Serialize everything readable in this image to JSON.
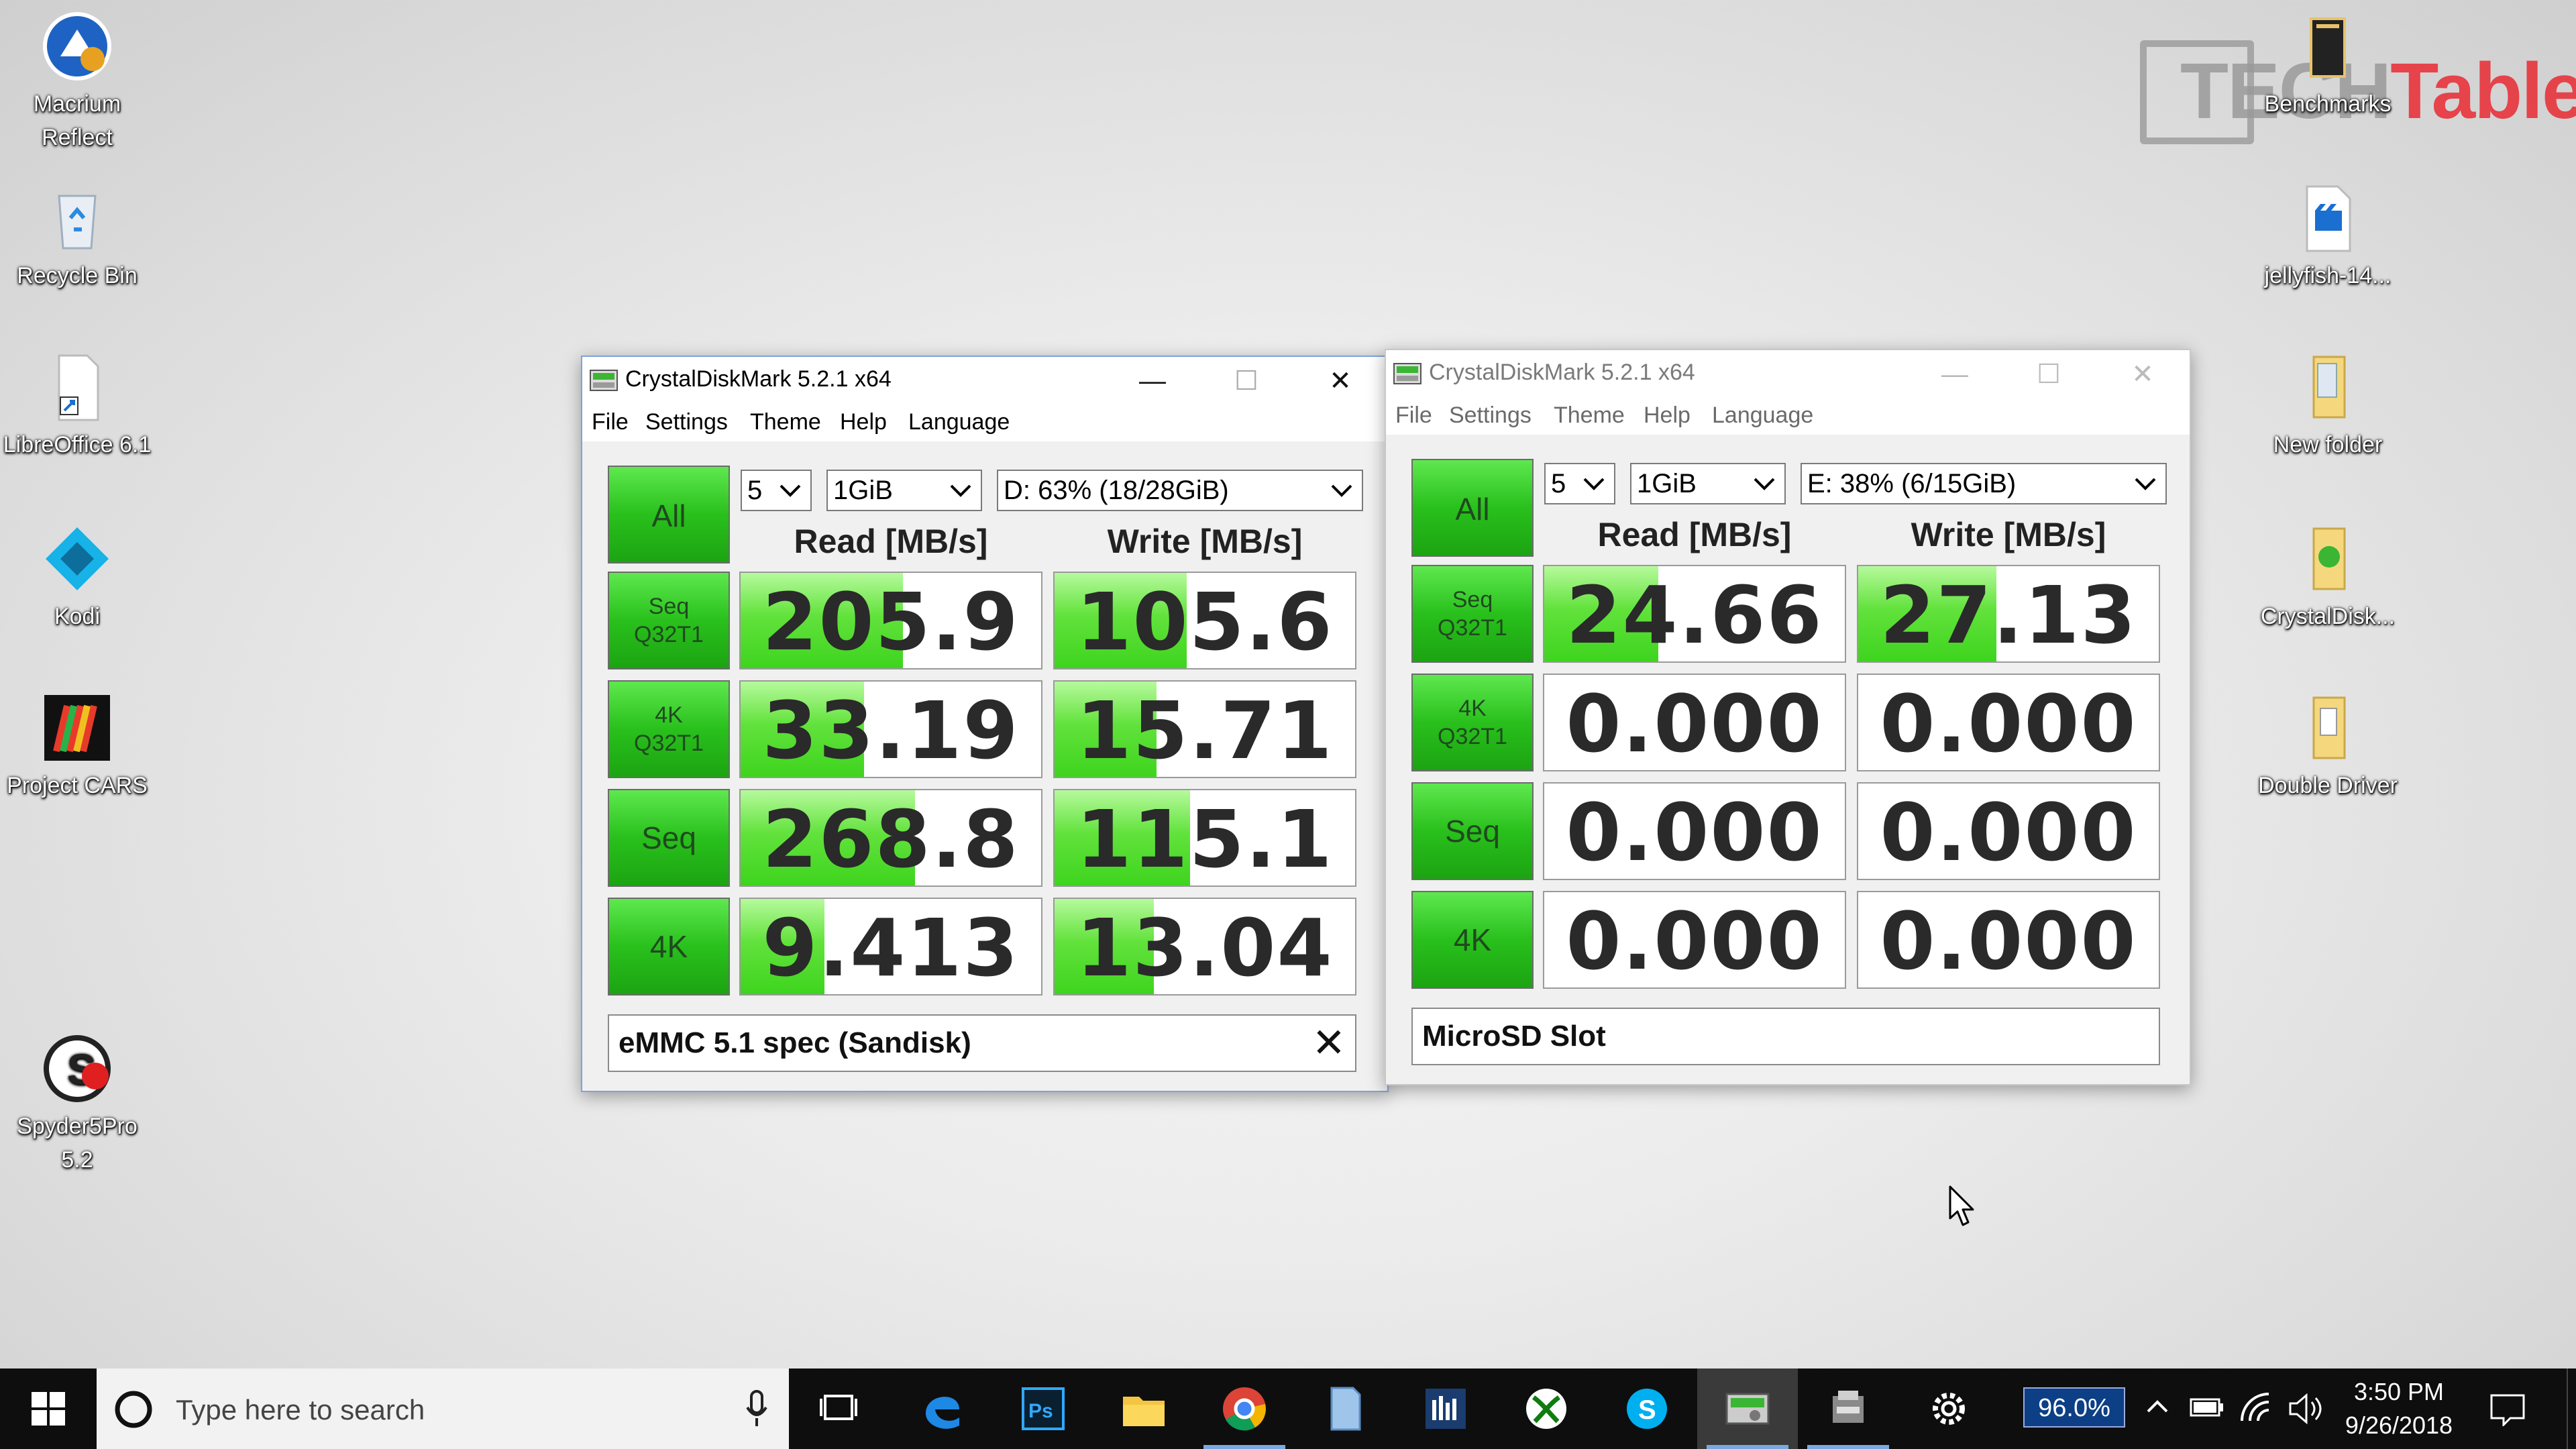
{
  "desktop": {
    "icons_left": [
      {
        "label": "Macrium Reflect",
        "icon": "macrium-reflect-icon"
      },
      {
        "label": "Recycle Bin",
        "icon": "recycle-bin-icon"
      },
      {
        "label": "LibreOffice 6.1",
        "icon": "libreoffice-icon"
      },
      {
        "label": "Kodi",
        "icon": "kodi-icon"
      },
      {
        "label": "Project CARS",
        "icon": "project-cars-icon"
      },
      {
        "label": "Spyder5Pro 5.2",
        "icon": "spyder5pro-icon"
      }
    ],
    "icons_right": [
      {
        "label": "Benchmarks",
        "icon": "benchmarks-folder-icon"
      },
      {
        "label": "jellyfish-14...",
        "icon": "video-file-icon"
      },
      {
        "label": "New folder",
        "icon": "folder-icon"
      },
      {
        "label": "CrystalDisk...",
        "icon": "crystaldisk-shortcut-icon"
      },
      {
        "label": "Double Driver",
        "icon": "folder-icon"
      }
    ],
    "watermark": {
      "part1": "TECH",
      "part2": "Tablets"
    }
  },
  "windows": [
    {
      "title": "CrystalDiskMark 5.2.1 x64",
      "active": true,
      "menu": [
        "File",
        "Settings",
        "Theme",
        "Help",
        "Language"
      ],
      "all_label": "All",
      "count": "5",
      "size": "1GiB",
      "drive": "D: 63% (18/28GiB)",
      "read_header": "Read [MB/s]",
      "write_header": "Write [MB/s]",
      "rows": [
        {
          "line1": "Seq",
          "line2": "Q32T1",
          "read": "205.9",
          "write": "105.6"
        },
        {
          "line1": "4K",
          "line2": "Q32T1",
          "read": "33.19",
          "write": "15.71"
        },
        {
          "line1": "Seq",
          "line2": "",
          "read": "268.8",
          "write": "115.1"
        },
        {
          "line1": "4K",
          "line2": "",
          "read": "9.413",
          "write": "13.04"
        }
      ],
      "comment": "eMMC 5.1 spec (Sandisk)"
    },
    {
      "title": "CrystalDiskMark 5.2.1 x64",
      "active": false,
      "menu": [
        "File",
        "Settings",
        "Theme",
        "Help",
        "Language"
      ],
      "all_label": "All",
      "count": "5",
      "size": "1GiB",
      "drive": "E: 38% (6/15GiB)",
      "read_header": "Read [MB/s]",
      "write_header": "Write [MB/s]",
      "rows": [
        {
          "line1": "Seq",
          "line2": "Q32T1",
          "read": "24.66",
          "write": "27.13"
        },
        {
          "line1": "4K",
          "line2": "Q32T1",
          "read": "0.000",
          "write": "0.000"
        },
        {
          "line1": "Seq",
          "line2": "",
          "read": "0.000",
          "write": "0.000"
        },
        {
          "line1": "4K",
          "line2": "",
          "read": "0.000",
          "write": "0.000"
        }
      ],
      "comment": "MicroSD Slot"
    }
  ],
  "taskbar": {
    "search_placeholder": "Type here to search",
    "pinned": [
      "task-view-icon",
      "edge-icon",
      "photoshop-icon",
      "file-explorer-icon",
      "chrome-icon",
      "notepad-icon",
      "app-icon",
      "xbox-icon",
      "skype-icon",
      "crystaldiskmark-icon",
      "app-icon-2",
      "settings-icon"
    ],
    "percent_badge": "96.0%",
    "time": "3:50 PM",
    "date": "9/26/2018"
  }
}
